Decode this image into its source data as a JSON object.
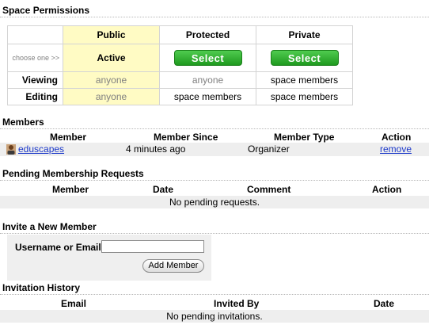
{
  "permissions": {
    "title": "Space Permissions",
    "choose_label": "choose one >>",
    "columns": [
      {
        "name": "Public",
        "status": "Active"
      },
      {
        "name": "Protected",
        "button": "Select"
      },
      {
        "name": "Private",
        "button": "Select"
      }
    ],
    "rows": [
      {
        "label": "Viewing",
        "values": [
          "anyone",
          "anyone",
          "space members"
        ]
      },
      {
        "label": "Editing",
        "values": [
          "anyone",
          "space members",
          "space members"
        ]
      }
    ],
    "highlight_color": "#fffbc4",
    "select_color": "#2eaa2e"
  },
  "members": {
    "title": "Members",
    "headers": [
      "Member",
      "Member Since",
      "Member Type",
      "Action"
    ],
    "rows": [
      {
        "member": "eduscapes",
        "since": "4 minutes ago",
        "type": "Organizer",
        "action": "remove",
        "icon": "user-icon"
      }
    ]
  },
  "pending": {
    "title": "Pending Membership Requests",
    "headers": [
      "Member",
      "Date",
      "Comment",
      "Action"
    ],
    "empty_text": "No pending requests."
  },
  "invite": {
    "title": "Invite a New Member",
    "field_label": "Username or Email",
    "field_value": "",
    "button_label": "Add Member"
  },
  "history": {
    "title": "Invitation History",
    "headers": [
      "Email",
      "Invited By",
      "Date"
    ],
    "empty_text": "No pending invitations."
  }
}
